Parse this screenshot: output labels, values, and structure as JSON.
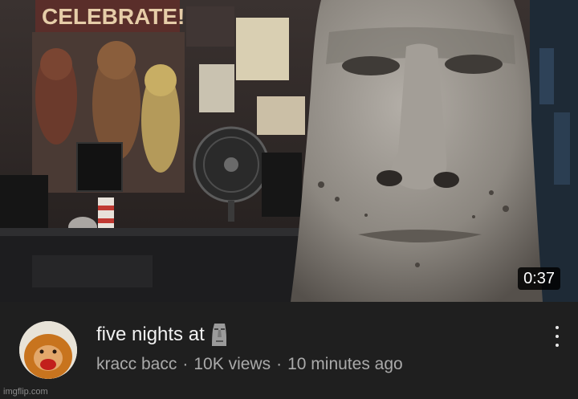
{
  "video": {
    "duration": "0:37",
    "title": "five nights at",
    "title_emoji": "moai-icon",
    "channel": "kracc bacc",
    "separator": "·",
    "views": "10K views",
    "age": "10 minutes ago"
  },
  "thumbnail": {
    "poster_text": "CELEBRATE!",
    "scene": "moai-statue-in-office"
  },
  "watermark": "imgflip.com",
  "icons": [
    "moai-icon",
    "more-options-icon"
  ],
  "colors": {
    "background": "#1f1f1f",
    "title": "#f1f1f1",
    "meta_text": "#aaaaaa",
    "duration_bg": "#000000"
  }
}
